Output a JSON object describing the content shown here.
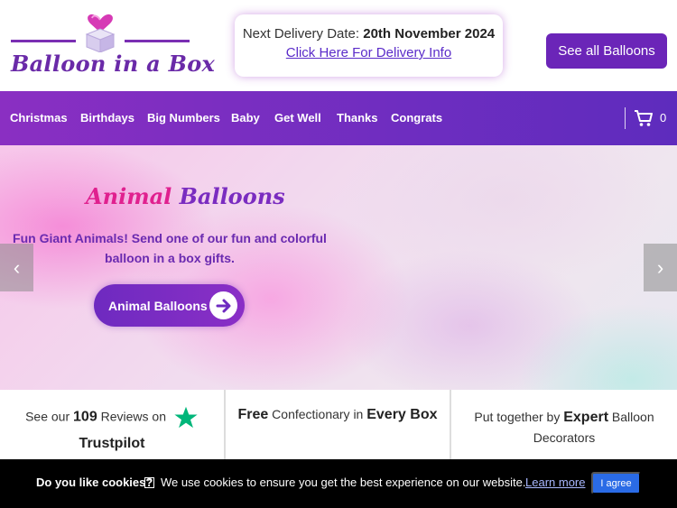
{
  "header": {
    "logo_text": "Balloon in a Box",
    "delivery_label": "Next Delivery Date:",
    "delivery_date": "20th November 2024",
    "delivery_link": "Click Here For Delivery Info",
    "see_all_label": "See all Balloons"
  },
  "nav": {
    "items": [
      "Christmas",
      "Birthdays",
      "Big Numbers",
      "Baby",
      "Get Well",
      "Thanks",
      "Congrats"
    ],
    "cart_count": "0"
  },
  "hero": {
    "title_part1": "Animal",
    "title_part2": "Balloons",
    "description": "Fun Giant Animals! Send one of our fun and colorful balloon in a box gifts.",
    "button_label": "Animal Balloons",
    "prev_label": "‹",
    "next_label": "›"
  },
  "features": {
    "reviews_prefix": "See our",
    "reviews_count": "109",
    "reviews_suffix": "Reviews on",
    "reviews_platform": "Trustpilot",
    "free_strong": "Free",
    "free_mid": "Confectionary in",
    "free_end": "Every Box",
    "expert_prefix": "Put together by",
    "expert_strong": "Expert",
    "expert_suffix": "Balloon Decorators"
  },
  "cookie": {
    "question": "Do you like cookies?",
    "help_symbol": "?",
    "message": "We use cookies to ensure you get the best experience on our website.",
    "learn_more": "Learn more",
    "agree": "I agree"
  },
  "colors": {
    "brand_purple": "#6b25b8",
    "accent_pink": "#e0208f",
    "trustpilot_green": "#00b67a"
  }
}
